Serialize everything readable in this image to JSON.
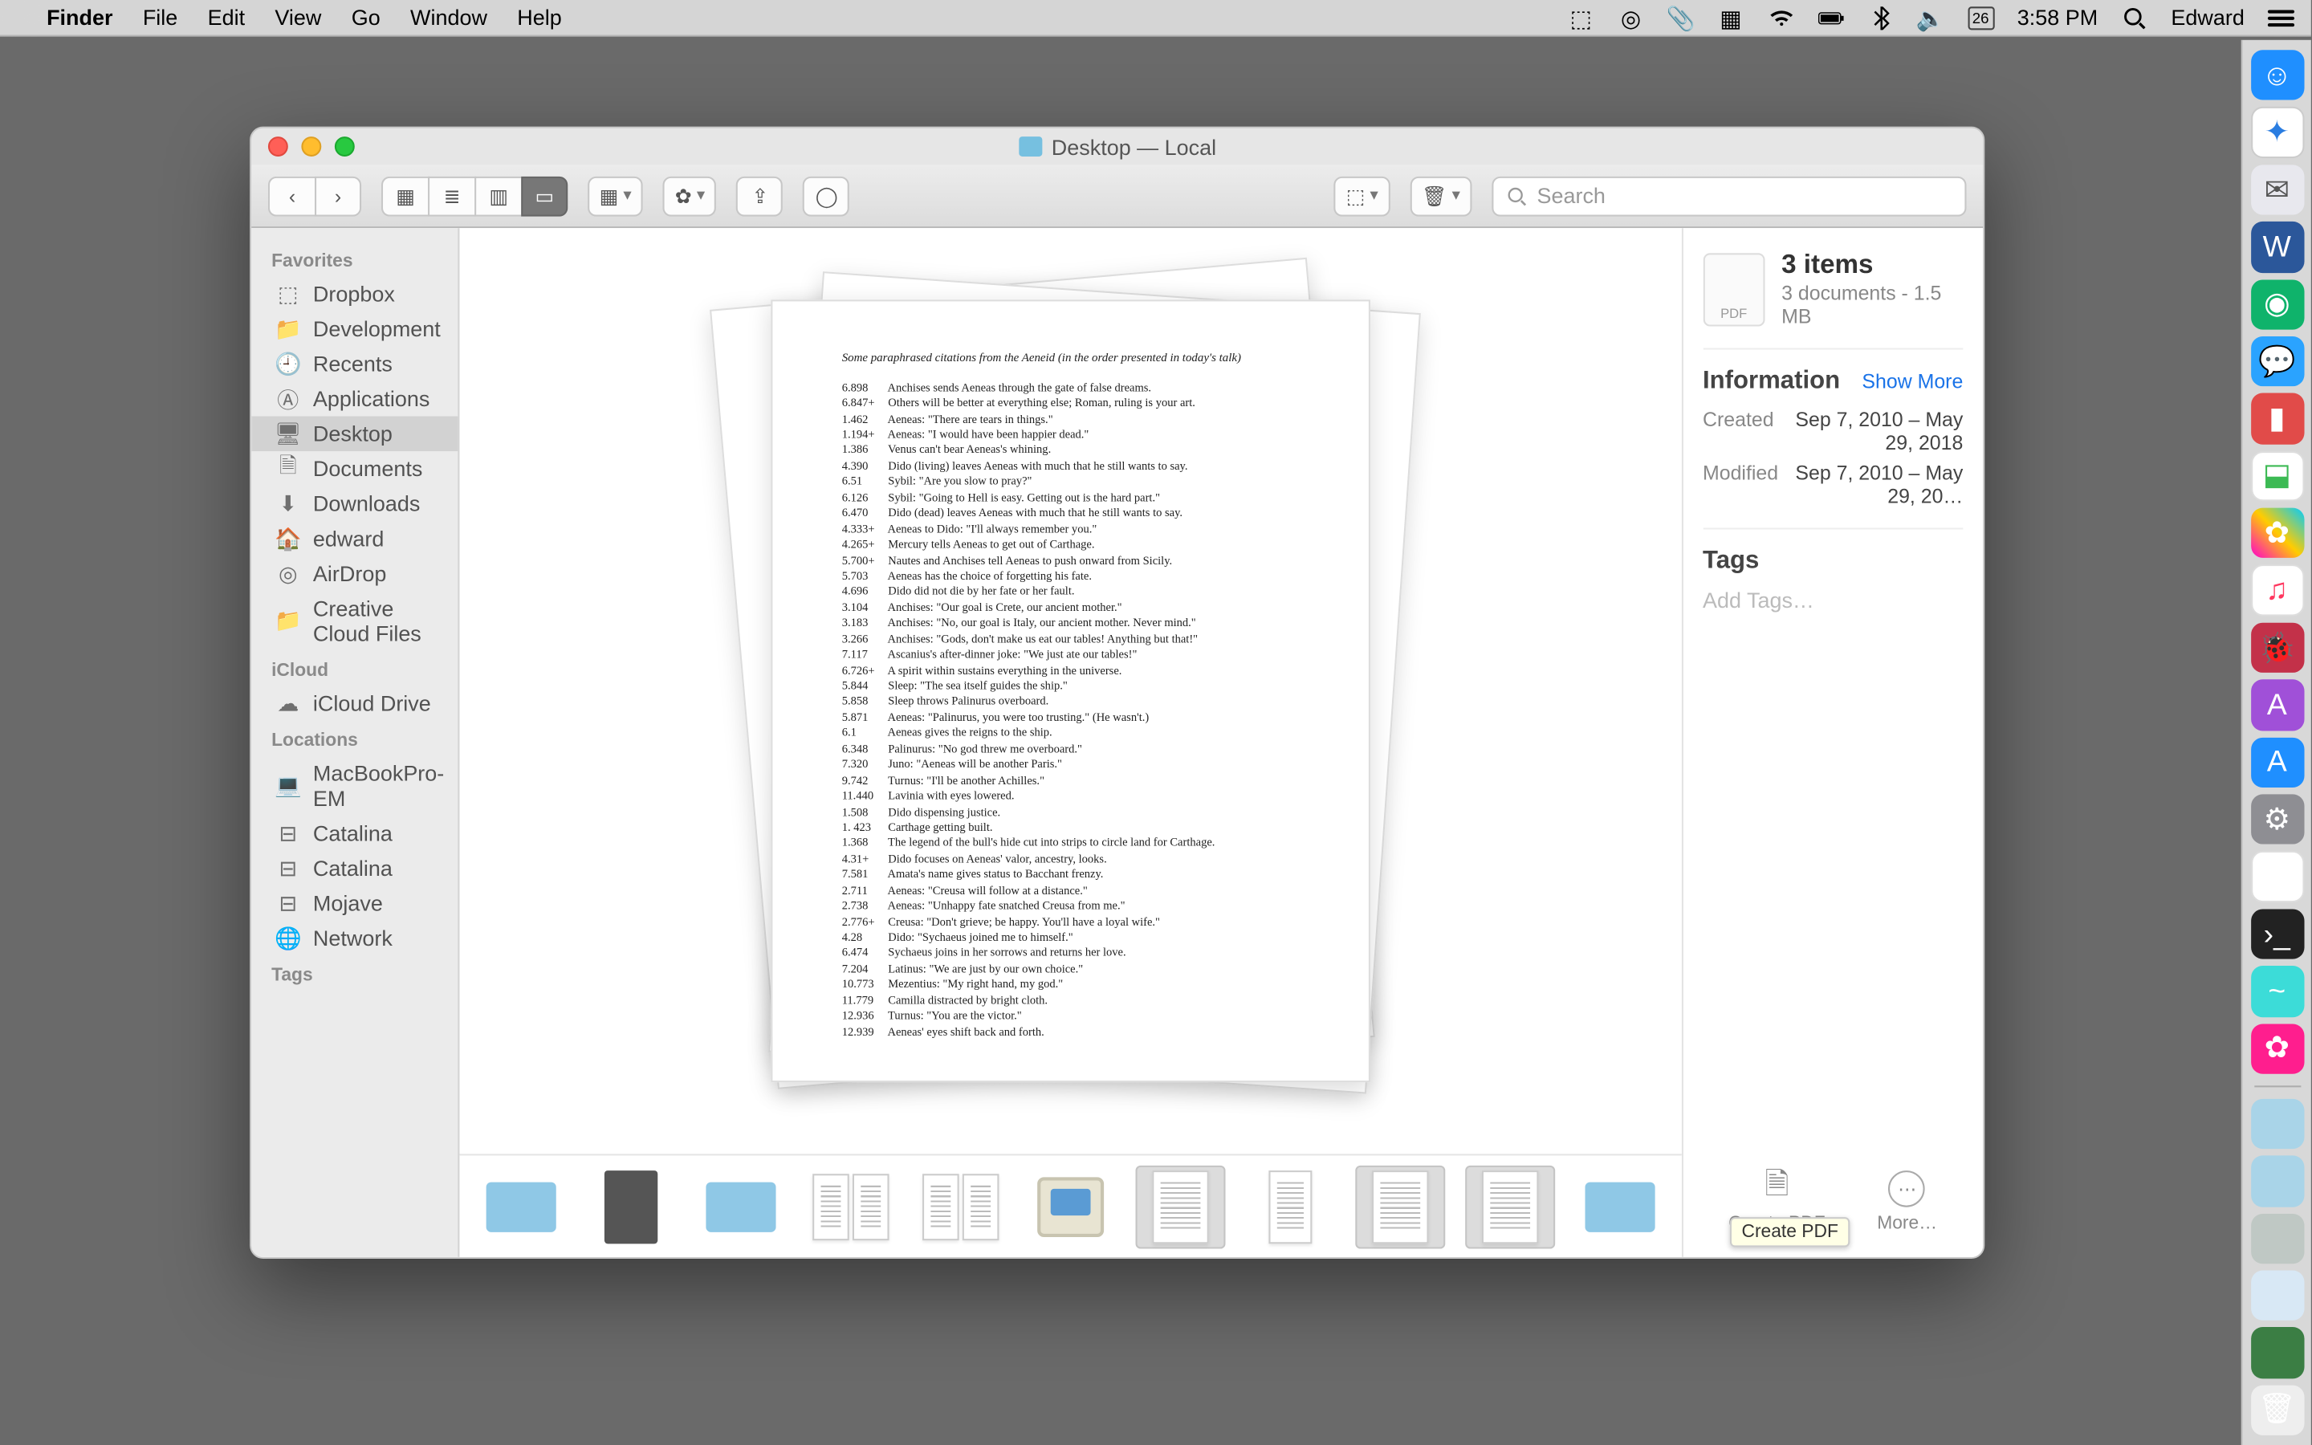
{
  "menubar": {
    "app_name": "Finder",
    "items": [
      "File",
      "Edit",
      "View",
      "Go",
      "Window",
      "Help"
    ],
    "cal_day": "26",
    "time": "3:58 PM",
    "user": "Edward"
  },
  "window": {
    "title": "Desktop — Local",
    "search_placeholder": "Search"
  },
  "sidebar": {
    "sections": [
      {
        "title": "Favorites",
        "items": [
          {
            "icon": "dropbox-icon",
            "label": "Dropbox"
          },
          {
            "icon": "folder-icon",
            "label": "Development"
          },
          {
            "icon": "clock-icon",
            "label": "Recents"
          },
          {
            "icon": "apps-icon",
            "label": "Applications"
          },
          {
            "icon": "desktop-icon",
            "label": "Desktop",
            "selected": true
          },
          {
            "icon": "docs-icon",
            "label": "Documents"
          },
          {
            "icon": "download-icon",
            "label": "Downloads"
          },
          {
            "icon": "home-icon",
            "label": "edward"
          },
          {
            "icon": "airdrop-icon",
            "label": "AirDrop"
          },
          {
            "icon": "folder-icon",
            "label": "Creative Cloud Files"
          }
        ]
      },
      {
        "title": "iCloud",
        "items": [
          {
            "icon": "cloud-icon",
            "label": "iCloud Drive"
          }
        ]
      },
      {
        "title": "Locations",
        "items": [
          {
            "icon": "laptop-icon",
            "label": "MacBookPro-EM"
          },
          {
            "icon": "disk-icon",
            "label": "Catalina"
          },
          {
            "icon": "disk-icon",
            "label": "Catalina"
          },
          {
            "icon": "disk-icon",
            "label": "Mojave"
          },
          {
            "icon": "globe-icon",
            "label": "Network"
          }
        ]
      },
      {
        "title": "Tags",
        "items": []
      }
    ]
  },
  "preview": {
    "subtitle": "Some paraphrased citations from the Aeneid (in the order presented in today's talk)",
    "lines": [
      [
        "6.898",
        "Anchises sends Aeneas through the gate of false dreams."
      ],
      [
        "6.847+",
        "Others will be better at everything else; Roman, ruling is your art."
      ],
      [
        "1.462",
        "Aeneas: \"There are tears in things.\""
      ],
      [
        "1.194+",
        "Aeneas: \"I would have been happier dead.\""
      ],
      [
        "1.386",
        "Venus can't bear Aeneas's whining."
      ],
      [
        "4.390",
        "Dido (living) leaves Aeneas with much that he still wants to say."
      ],
      [
        "6.51",
        "Sybil: \"Are you slow to pray?\""
      ],
      [
        "6.126",
        "Sybil: \"Going to Hell is easy. Getting out is the hard part.\""
      ],
      [
        "6.470",
        "Dido (dead) leaves Aeneas with much that he still wants to say."
      ],
      [
        "4.333+",
        "Aeneas to Dido: \"I'll always remember you.\""
      ],
      [
        "4.265+",
        "Mercury tells Aeneas to get out of Carthage."
      ],
      [
        "5.700+",
        "Nautes and Anchises tell Aeneas to push onward from Sicily."
      ],
      [
        "5.703",
        "Aeneas has the choice of forgetting his fate."
      ],
      [
        "4.696",
        "Dido did not die by her fate or her fault."
      ],
      [
        "3.104",
        "Anchises: \"Our goal is Crete, our ancient mother.\""
      ],
      [
        "3.183",
        "Anchises: \"No, our goal is Italy, our ancient mother. Never mind.\""
      ],
      [
        "3.266",
        "Anchises: \"Gods, don't make us eat our tables! Anything but that!\""
      ],
      [
        "7.117",
        "Ascanius's after-dinner joke: \"We just ate our tables!\""
      ],
      [
        "6.726+",
        "A spirit within sustains everything in the universe."
      ],
      [
        "5.844",
        "Sleep: \"The sea itself guides the ship.\""
      ],
      [
        "5.858",
        "Sleep throws Palinurus overboard."
      ],
      [
        "5.871",
        "Aeneas: \"Palinurus, you were too trusting.\" (He wasn't.)"
      ],
      [
        "6.1",
        "Aeneas gives the reigns to the ship."
      ],
      [
        "6.348",
        "Palinurus: \"No god threw me overboard.\""
      ],
      [
        "7.320",
        "Juno: \"Aeneas will be another Paris.\""
      ],
      [
        "9.742",
        "Turnus: \"I'll be another Achilles.\""
      ],
      [
        "11.440",
        "Lavinia with eyes lowered."
      ],
      [
        "1.508",
        "Dido dispensing justice."
      ],
      [
        "1. 423",
        "Carthage getting built."
      ],
      [
        "1.368",
        "The legend of the bull's hide cut into strips to circle land for Carthage."
      ],
      [
        "4.31+",
        "Dido focuses on Aeneas' valor, ancestry, looks."
      ],
      [
        "7.581",
        "Amata's name gives status to Bacchant frenzy."
      ],
      [
        "2.711",
        "Aeneas: \"Creusa will follow at a distance.\""
      ],
      [
        "2.738",
        "Aeneas: \"Unhappy fate snatched Creusa from me.\""
      ],
      [
        "2.776+",
        "Creusa: \"Don't grieve; be happy. You'll have a loyal wife.\""
      ],
      [
        "4.28",
        "Dido: \"Sychaeus joined me to himself.\""
      ],
      [
        "6.474",
        "Sychaeus joins in her sorrows and returns her love."
      ],
      [
        "7.204",
        "Latinus: \"We are just by our own choice.\""
      ],
      [
        "10.773",
        "Mezentius: \"My right hand, my god.\""
      ],
      [
        "11.779",
        "Camilla distracted by bright cloth."
      ],
      [
        "12.936",
        "Turnus: \"You are the victor.\""
      ],
      [
        "12.939",
        "Aeneas' eyes shift back and forth."
      ]
    ]
  },
  "inspector": {
    "title": "3 items",
    "subtitle": "3 documents - 1.5 MB",
    "information_label": "Information",
    "show_more": "Show More",
    "created_label": "Created",
    "created_value": "Sep 7, 2010 – May 29, 2018",
    "modified_label": "Modified",
    "modified_value": "Sep 7, 2010 – May 29, 20…",
    "tags_label": "Tags",
    "add_tags": "Add Tags…",
    "action_createpdf": "Create PDF",
    "action_more": "More…",
    "tooltip": "Create PDF"
  }
}
